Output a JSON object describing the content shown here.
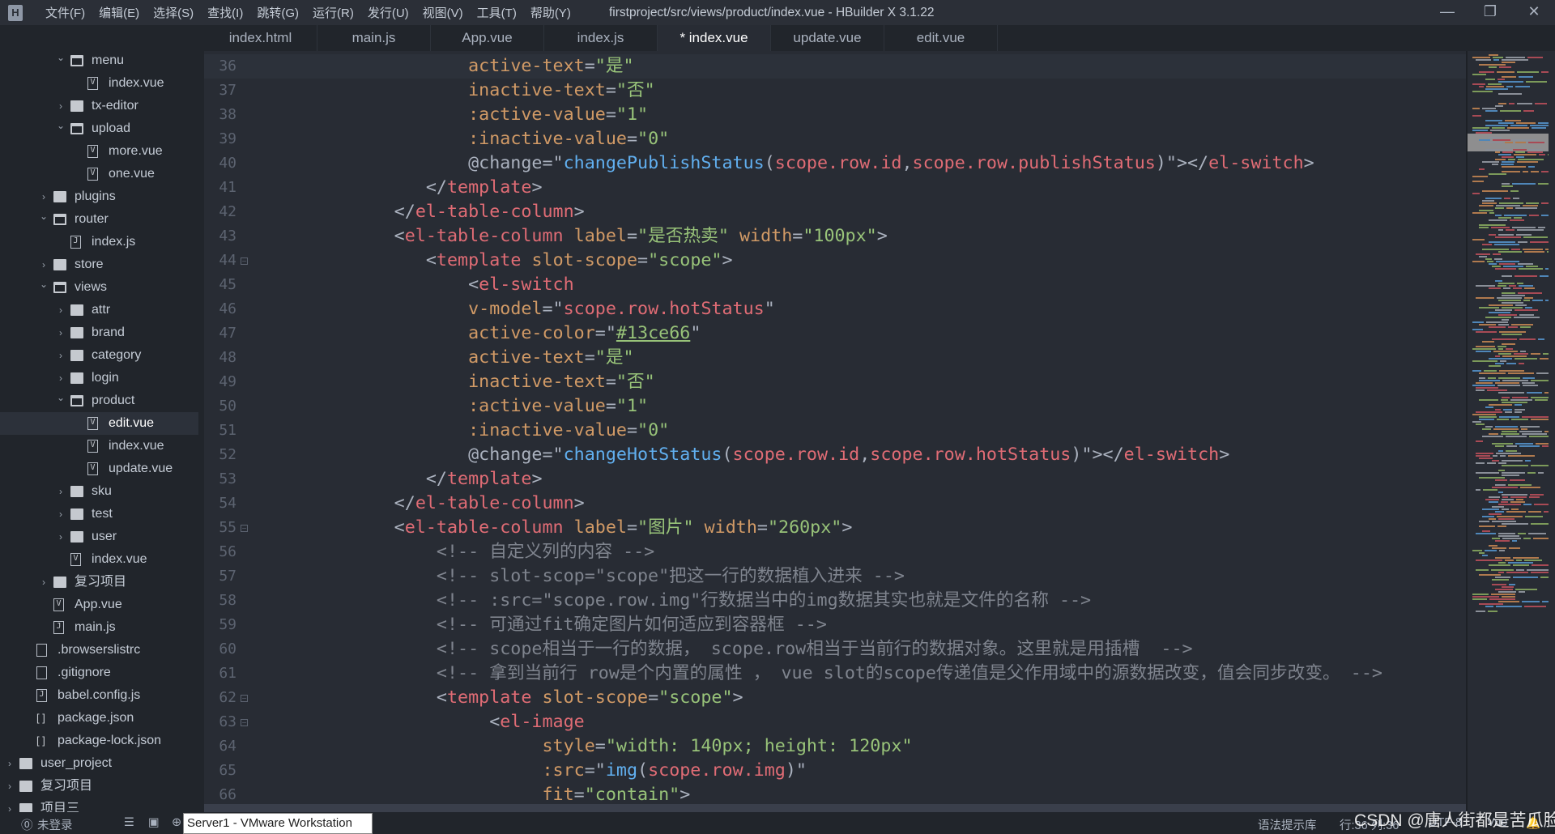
{
  "app": {
    "title": "firstproject/src/views/product/index.vue - HBuilder X 3.1.22",
    "logo": "H",
    "menu": [
      "文件(F)",
      "编辑(E)",
      "选择(S)",
      "查找(I)",
      "跳转(G)",
      "运行(R)",
      "发行(U)",
      "视图(V)",
      "工具(T)",
      "帮助(Y)"
    ],
    "window_controls": {
      "minimize": "—",
      "maximize": "❐",
      "close": "✕"
    }
  },
  "tabs": [
    {
      "label": "index.html",
      "active": false
    },
    {
      "label": "main.js",
      "active": false
    },
    {
      "label": "App.vue",
      "active": false
    },
    {
      "label": "index.js",
      "active": false
    },
    {
      "label": "* index.vue",
      "active": true
    },
    {
      "label": "update.vue",
      "active": false
    },
    {
      "label": "edit.vue",
      "active": false
    }
  ],
  "tree": [
    {
      "label": "menu",
      "depth": 3,
      "type": "folder",
      "expanded": true
    },
    {
      "label": "index.vue",
      "depth": 4,
      "type": "vue"
    },
    {
      "label": "tx-editor",
      "depth": 3,
      "type": "folder",
      "expanded": false
    },
    {
      "label": "upload",
      "depth": 3,
      "type": "folder",
      "expanded": true
    },
    {
      "label": "more.vue",
      "depth": 4,
      "type": "vue"
    },
    {
      "label": "one.vue",
      "depth": 4,
      "type": "vue"
    },
    {
      "label": "plugins",
      "depth": 2,
      "type": "folder",
      "expanded": false
    },
    {
      "label": "router",
      "depth": 2,
      "type": "folder",
      "expanded": true
    },
    {
      "label": "index.js",
      "depth": 3,
      "type": "js"
    },
    {
      "label": "store",
      "depth": 2,
      "type": "folder",
      "expanded": false
    },
    {
      "label": "views",
      "depth": 2,
      "type": "folder",
      "expanded": true
    },
    {
      "label": "attr",
      "depth": 3,
      "type": "folder",
      "expanded": false
    },
    {
      "label": "brand",
      "depth": 3,
      "type": "folder",
      "expanded": false
    },
    {
      "label": "category",
      "depth": 3,
      "type": "folder",
      "expanded": false
    },
    {
      "label": "login",
      "depth": 3,
      "type": "folder",
      "expanded": false
    },
    {
      "label": "product",
      "depth": 3,
      "type": "folder",
      "expanded": true
    },
    {
      "label": "edit.vue",
      "depth": 4,
      "type": "vue",
      "selected": true
    },
    {
      "label": "index.vue",
      "depth": 4,
      "type": "vue"
    },
    {
      "label": "update.vue",
      "depth": 4,
      "type": "vue"
    },
    {
      "label": "sku",
      "depth": 3,
      "type": "folder",
      "expanded": false
    },
    {
      "label": "test",
      "depth": 3,
      "type": "folder",
      "expanded": false
    },
    {
      "label": "user",
      "depth": 3,
      "type": "folder",
      "expanded": false
    },
    {
      "label": "index.vue",
      "depth": 3,
      "type": "vue"
    },
    {
      "label": "复习项目",
      "depth": 2,
      "type": "folder",
      "expanded": false
    },
    {
      "label": "App.vue",
      "depth": 2,
      "type": "vue"
    },
    {
      "label": "main.js",
      "depth": 2,
      "type": "js"
    },
    {
      "label": ".browserslistrc",
      "depth": 1,
      "type": "file"
    },
    {
      "label": ".gitignore",
      "depth": 1,
      "type": "file"
    },
    {
      "label": "babel.config.js",
      "depth": 1,
      "type": "js"
    },
    {
      "label": "package.json",
      "depth": 1,
      "type": "json"
    },
    {
      "label": "package-lock.json",
      "depth": 1,
      "type": "json"
    },
    {
      "label": "user_project",
      "depth": 0,
      "type": "project",
      "expanded": false
    },
    {
      "label": "复习项目",
      "depth": 0,
      "type": "project",
      "expanded": false
    },
    {
      "label": "项目三",
      "depth": 0,
      "type": "project",
      "expanded": false
    }
  ],
  "editor": {
    "current_line": 36,
    "lines": [
      {
        "n": 36,
        "tokens": [
          [
            "p",
            "                   "
          ],
          [
            "a",
            "active-text"
          ],
          [
            "p",
            "="
          ],
          [
            "s",
            "\"是\""
          ]
        ]
      },
      {
        "n": 37,
        "tokens": [
          [
            "p",
            "                   "
          ],
          [
            "a",
            "inactive-text"
          ],
          [
            "p",
            "="
          ],
          [
            "s",
            "\"否\""
          ]
        ]
      },
      {
        "n": 38,
        "tokens": [
          [
            "p",
            "                   "
          ],
          [
            "a",
            ":active-value"
          ],
          [
            "p",
            "="
          ],
          [
            "s",
            "\"1\""
          ]
        ]
      },
      {
        "n": 39,
        "tokens": [
          [
            "p",
            "                   "
          ],
          [
            "a",
            ":inactive-value"
          ],
          [
            "p",
            "="
          ],
          [
            "s",
            "\"0\""
          ]
        ]
      },
      {
        "n": 40,
        "tokens": [
          [
            "p",
            "                   @change=\""
          ],
          [
            "f",
            "changePublishStatus"
          ],
          [
            "p",
            "("
          ],
          [
            "v",
            "scope.row.id"
          ],
          [
            "p",
            ","
          ],
          [
            "v",
            "scope.row.publishStatus"
          ],
          [
            "p",
            ")\"></"
          ],
          [
            "t",
            "el-switch"
          ],
          [
            "p",
            ">"
          ]
        ]
      },
      {
        "n": 41,
        "tokens": [
          [
            "p",
            "               </"
          ],
          [
            "t",
            "template"
          ],
          [
            "p",
            ">"
          ]
        ]
      },
      {
        "n": 42,
        "tokens": [
          [
            "p",
            "            </"
          ],
          [
            "t",
            "el-table-column"
          ],
          [
            "p",
            ">"
          ]
        ]
      },
      {
        "n": 43,
        "tokens": [
          [
            "p",
            "            <"
          ],
          [
            "t",
            "el-table-column"
          ],
          [
            "p",
            " "
          ],
          [
            "a",
            "label"
          ],
          [
            "p",
            "="
          ],
          [
            "s",
            "\"是否热卖\""
          ],
          [
            "p",
            " "
          ],
          [
            "a",
            "width"
          ],
          [
            "p",
            "="
          ],
          [
            "s",
            "\"100px\""
          ],
          [
            "p",
            ">"
          ]
        ]
      },
      {
        "n": 44,
        "fold": true,
        "tokens": [
          [
            "p",
            "               <"
          ],
          [
            "t",
            "template"
          ],
          [
            "p",
            " "
          ],
          [
            "a",
            "slot-scope"
          ],
          [
            "p",
            "="
          ],
          [
            "s",
            "\"scope\""
          ],
          [
            "p",
            ">"
          ]
        ]
      },
      {
        "n": 45,
        "tokens": [
          [
            "p",
            "                   <"
          ],
          [
            "t",
            "el-switch"
          ]
        ]
      },
      {
        "n": 46,
        "tokens": [
          [
            "p",
            "                   "
          ],
          [
            "a",
            "v-model"
          ],
          [
            "p",
            "=\""
          ],
          [
            "v",
            "scope.row.hotStatus"
          ],
          [
            "p",
            "\""
          ]
        ]
      },
      {
        "n": 47,
        "tokens": [
          [
            "p",
            "                   "
          ],
          [
            "a",
            "active-color"
          ],
          [
            "p",
            "=\""
          ],
          [
            "u",
            "#13ce66"
          ],
          [
            "p",
            "\""
          ]
        ]
      },
      {
        "n": 48,
        "tokens": [
          [
            "p",
            "                   "
          ],
          [
            "a",
            "active-text"
          ],
          [
            "p",
            "="
          ],
          [
            "s",
            "\"是\""
          ]
        ]
      },
      {
        "n": 49,
        "tokens": [
          [
            "p",
            "                   "
          ],
          [
            "a",
            "inactive-text"
          ],
          [
            "p",
            "="
          ],
          [
            "s",
            "\"否\""
          ]
        ]
      },
      {
        "n": 50,
        "tokens": [
          [
            "p",
            "                   "
          ],
          [
            "a",
            ":active-value"
          ],
          [
            "p",
            "="
          ],
          [
            "s",
            "\"1\""
          ]
        ]
      },
      {
        "n": 51,
        "tokens": [
          [
            "p",
            "                   "
          ],
          [
            "a",
            ":inactive-value"
          ],
          [
            "p",
            "="
          ],
          [
            "s",
            "\"0\""
          ]
        ]
      },
      {
        "n": 52,
        "tokens": [
          [
            "p",
            "                   @change=\""
          ],
          [
            "f",
            "changeHotStatus"
          ],
          [
            "p",
            "("
          ],
          [
            "v",
            "scope.row.id"
          ],
          [
            "p",
            ","
          ],
          [
            "v",
            "scope.row.hotStatus"
          ],
          [
            "p",
            ")\"></"
          ],
          [
            "t",
            "el-switch"
          ],
          [
            "p",
            ">"
          ]
        ]
      },
      {
        "n": 53,
        "tokens": [
          [
            "p",
            "               </"
          ],
          [
            "t",
            "template"
          ],
          [
            "p",
            ">"
          ]
        ]
      },
      {
        "n": 54,
        "tokens": [
          [
            "p",
            "            </"
          ],
          [
            "t",
            "el-table-column"
          ],
          [
            "p",
            ">"
          ]
        ]
      },
      {
        "n": 55,
        "fold": true,
        "tokens": [
          [
            "p",
            "            <"
          ],
          [
            "t",
            "el-table-column"
          ],
          [
            "p",
            " "
          ],
          [
            "a",
            "label"
          ],
          [
            "p",
            "="
          ],
          [
            "s",
            "\"图片\""
          ],
          [
            "p",
            " "
          ],
          [
            "a",
            "width"
          ],
          [
            "p",
            "="
          ],
          [
            "s",
            "\"260px\""
          ],
          [
            "p",
            ">"
          ]
        ]
      },
      {
        "n": 56,
        "tokens": [
          [
            "c",
            "                <!-- 自定义列的内容 -->"
          ]
        ]
      },
      {
        "n": 57,
        "tokens": [
          [
            "c",
            "                <!-- slot-scop=\"scope\"把这一行的数据植入进来 -->"
          ]
        ]
      },
      {
        "n": 58,
        "tokens": [
          [
            "c",
            "                <!-- :src=\"scope.row.img\"行数据当中的img数据其实也就是文件的名称 -->"
          ]
        ]
      },
      {
        "n": 59,
        "tokens": [
          [
            "c",
            "                <!-- 可通过fit确定图片如何适应到容器框 -->"
          ]
        ]
      },
      {
        "n": 60,
        "tokens": [
          [
            "c",
            "                <!-- scope相当于一行的数据， scope.row相当于当前行的数据对象。这里就是用插槽  -->"
          ]
        ]
      },
      {
        "n": 61,
        "tokens": [
          [
            "c",
            "                <!-- 拿到当前行 row是个内置的属性 ， vue slot的scope传递值是父作用域中的源数据改变，值会同步改变。 -->"
          ]
        ]
      },
      {
        "n": 62,
        "fold": true,
        "tokens": [
          [
            "p",
            "                <"
          ],
          [
            "t",
            "template"
          ],
          [
            "p",
            " "
          ],
          [
            "a",
            "slot-scope"
          ],
          [
            "p",
            "="
          ],
          [
            "s",
            "\"scope\""
          ],
          [
            "p",
            ">"
          ]
        ]
      },
      {
        "n": 63,
        "fold": true,
        "tokens": [
          [
            "p",
            "                     <"
          ],
          [
            "t",
            "el-image"
          ]
        ]
      },
      {
        "n": 64,
        "tokens": [
          [
            "p",
            "                          "
          ],
          [
            "a",
            "style"
          ],
          [
            "p",
            "="
          ],
          [
            "s",
            "\"width: 140px; height: 120px\""
          ]
        ]
      },
      {
        "n": 65,
        "tokens": [
          [
            "p",
            "                          "
          ],
          [
            "a",
            ":src"
          ],
          [
            "p",
            "=\""
          ],
          [
            "f",
            "img"
          ],
          [
            "p",
            "("
          ],
          [
            "v",
            "scope.row.img"
          ],
          [
            "p",
            ")\""
          ]
        ]
      },
      {
        "n": 66,
        "tokens": [
          [
            "p",
            "                          "
          ],
          [
            "a",
            "fit"
          ],
          [
            "p",
            "="
          ],
          [
            "s",
            "\"contain\""
          ],
          [
            "p",
            ">"
          ]
        ]
      }
    ]
  },
  "statusbar": {
    "login": "未登录",
    "tooltip": "Server1 - VMware Workstation",
    "syntax_lib": "语法提示库",
    "position": "行:36  列:36",
    "encoding": "UTF-8",
    "language": "Vue"
  },
  "watermark": "CSDN @唐人街都是苦瓜脸",
  "colors": {
    "tag": "#e06c75",
    "attr": "#d19a66",
    "string": "#98c379",
    "function": "#61afef",
    "comment": "#7f848e",
    "background": "#282c34",
    "sidebar": "#21252b"
  }
}
